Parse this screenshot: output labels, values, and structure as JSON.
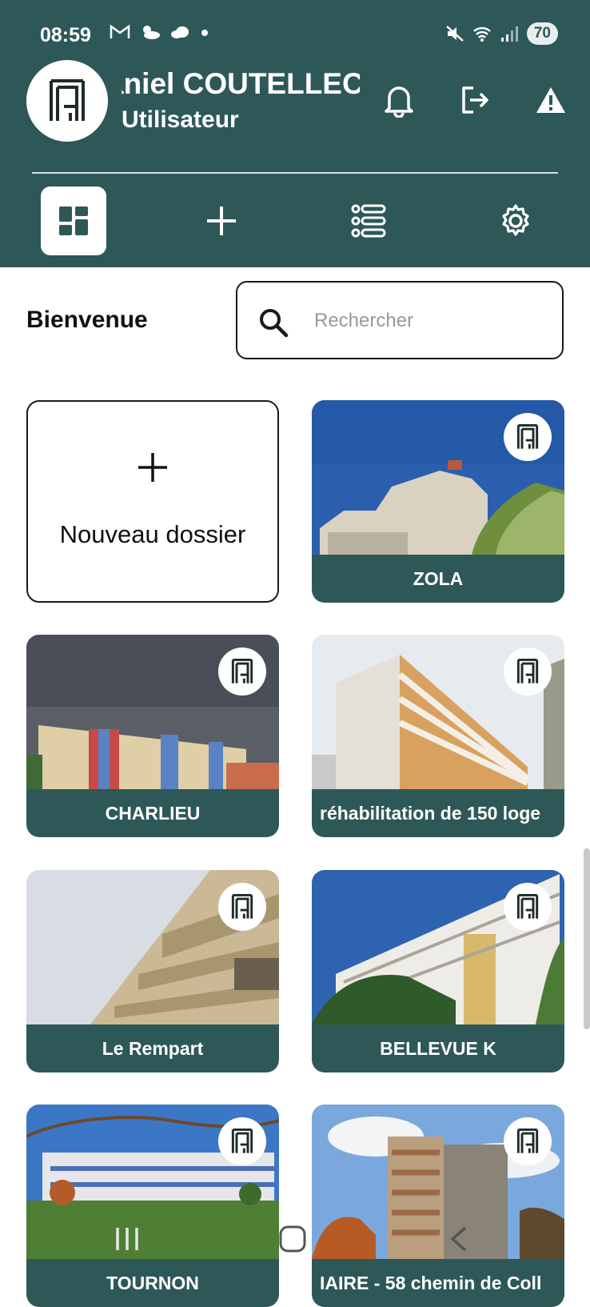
{
  "status_bar": {
    "time": "08:59",
    "left_icons": [
      "gmail-icon",
      "weather-icon",
      "cloud-icon",
      "dot-icon"
    ],
    "right_icons": [
      "mute-icon",
      "wifi-icon",
      "signal-icon"
    ],
    "battery": "70"
  },
  "user": {
    "name": "aniel COUTELLEC",
    "role": "Utilisateur"
  },
  "header_actions": [
    "bell-icon",
    "logout-icon",
    "warning-icon"
  ],
  "nav_tabs": [
    {
      "name": "dashboard",
      "icon": "grid-icon",
      "active": true
    },
    {
      "name": "add",
      "icon": "plus-icon",
      "active": false
    },
    {
      "name": "list",
      "icon": "list-icon",
      "active": false
    },
    {
      "name": "settings",
      "icon": "gear-icon",
      "active": false
    }
  ],
  "main": {
    "welcome": "Bienvenue",
    "search_placeholder": "Rechercher"
  },
  "new_folder": {
    "label": "Nouveau dossier"
  },
  "folders": [
    {
      "label": "ZOLA"
    },
    {
      "label": "CHARLIEU"
    },
    {
      "label": "réhabilitation de 150 loge"
    },
    {
      "label": "Le Rempart"
    },
    {
      "label": "BELLEVUE K"
    },
    {
      "label": "TOURNON"
    },
    {
      "label": "IAIRE - 58 chemin de Coll"
    }
  ],
  "colors": {
    "primary": "#2e5858",
    "background": "#ffffff",
    "text": "#111111"
  },
  "system_nav": [
    "recents-icon",
    "home-icon",
    "back-icon"
  ]
}
